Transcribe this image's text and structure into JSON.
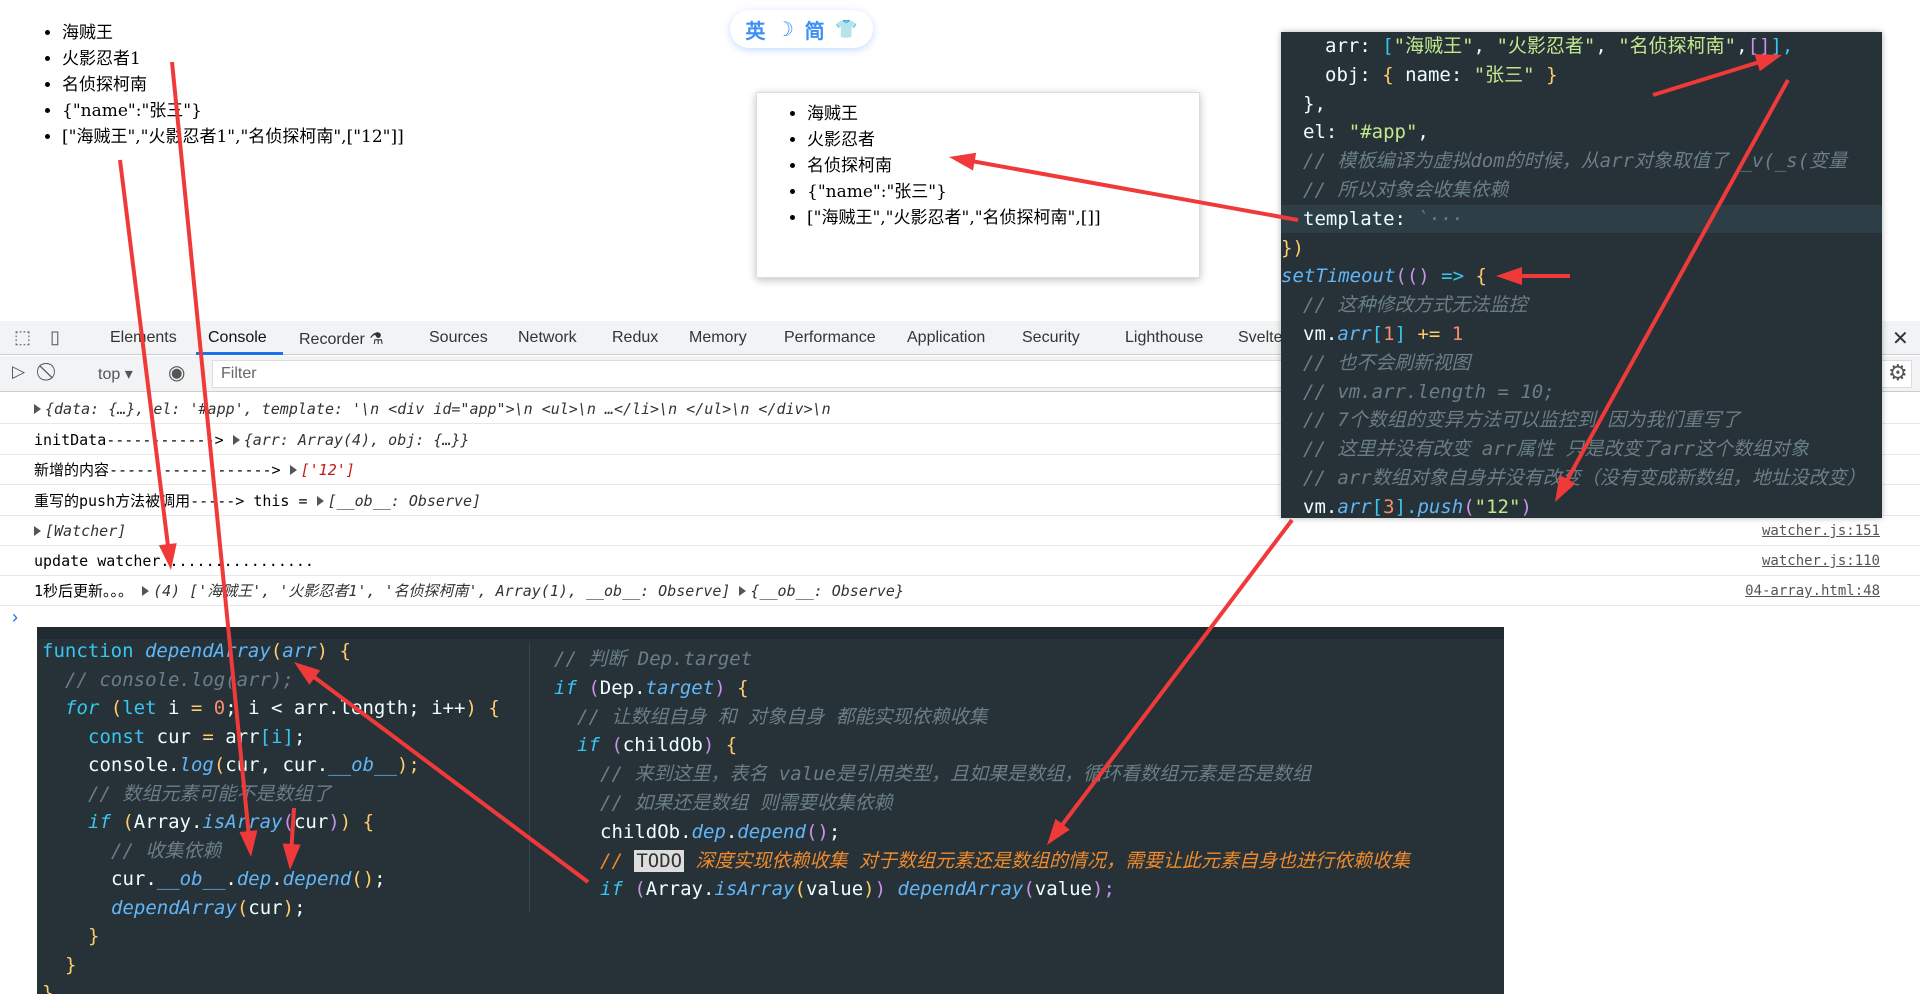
{
  "page": {
    "list": [
      "海贼王",
      "火影忍者1",
      "名侦探柯南",
      "{\"name\":\"张三\"}",
      "[\"海贼王\",\"火影忍者1\",\"名侦探柯南\",[\"12\"]]"
    ]
  },
  "toggle": {
    "lang": "英",
    "moon": "☽",
    "simp": "简",
    "shirt": "👕"
  },
  "preview": {
    "list": [
      "海贼王",
      "火影忍者",
      "名侦探柯南",
      "{\"name\":\"张三\"}",
      "[\"海贼王\",\"火影忍者\",\"名侦探柯南\",[]]"
    ]
  },
  "devtools": {
    "tabs": [
      "Elements",
      "Console",
      "Recorder ⚗",
      "Sources",
      "Network",
      "Redux",
      "Memory",
      "Performance",
      "Application",
      "Security",
      "Lighthouse",
      "Svelte"
    ],
    "active_tab": "Console",
    "context": "top ▾",
    "filter_placeholder": "Filter",
    "close": "✕",
    "settings": "⚙",
    "prompt": "›",
    "rows": [
      {
        "text": "{data: {…}, el: '#app', template: '\\n        <div id=\"app\">\\n          <ul>\\n          …</li>\\n          </ul>\\n        </div>\\n",
        "src": ""
      },
      {
        "text": "initData------------>",
        "obj": "{arr: Array(4), obj: {…}}",
        "src": ""
      },
      {
        "text": "新增的内容------------------>",
        "obj": "['12']",
        "src": ""
      },
      {
        "text": "重写的push方法被调用----->  this = ",
        "obj": "[__ob__: Observe]",
        "src": ""
      },
      {
        "text": "",
        "obj": "[Watcher]",
        "src": "watcher.js:151"
      },
      {
        "text": "update watcher.................",
        "obj": "",
        "src": "watcher.js:110"
      },
      {
        "text": "1秒后更新。。。",
        "obj": "(4) ['海贼王', '火影忍者1', '名侦探柯南', Array(1), __ob__: Observe]",
        "obj2": "{__ob__: Observe}",
        "src": "04-array.html:48"
      }
    ]
  },
  "code_right": [
    [
      2,
      [
        [
          "arr: ",
          "pl"
        ],
        [
          "[",
          "kw"
        ],
        [
          "\"海贼王\"",
          "str"
        ],
        [
          ", ",
          "pl"
        ],
        [
          "\"火影忍者\"",
          "str"
        ],
        [
          ", ",
          "pl"
        ],
        [
          "\"名侦探柯南\"",
          "str"
        ],
        [
          ",",
          "pl"
        ],
        [
          "[]",
          "pk"
        ],
        [
          "],",
          "kw"
        ]
      ]
    ],
    [
      2,
      [
        [
          "obj: ",
          "pl"
        ],
        [
          "{ ",
          "yl"
        ],
        [
          "name: ",
          "pl"
        ],
        [
          "\"张三\"",
          "str"
        ],
        [
          " }",
          "yl"
        ]
      ]
    ],
    [
      1,
      [
        [
          "},",
          "pl"
        ]
      ]
    ],
    [
      1,
      [
        [
          "el: ",
          "pl"
        ],
        [
          "\"#app\"",
          "str"
        ],
        [
          ",",
          "pl"
        ]
      ]
    ],
    [
      1,
      [
        [
          "// 模板编译为虚拟dom的时候，从arr对象取值了 _v(_s(变量",
          "cm"
        ]
      ]
    ],
    [
      1,
      [
        [
          "// 所以对象会收集依赖",
          "cm"
        ]
      ]
    ],
    [
      1,
      [
        [
          "template: ",
          "pl"
        ],
        [
          "`···",
          "cm"
        ]
      ]
    ],
    [
      0,
      [
        [
          "})",
          "yl"
        ]
      ]
    ],
    [
      0,
      [
        [
          "setTimeout",
          "fn"
        ],
        [
          "(() ",
          "pk"
        ],
        [
          "=> ",
          "kw"
        ],
        [
          "{",
          "yl"
        ]
      ]
    ],
    [
      1,
      [
        [
          "// 这种修改方式无法监控",
          "cm"
        ]
      ]
    ],
    [
      1,
      [
        [
          "vm.",
          "pl"
        ],
        [
          "arr",
          "fn"
        ],
        [
          "[",
          "kw"
        ],
        [
          "1",
          "or"
        ],
        [
          "] ",
          "kw"
        ],
        [
          "+= ",
          "yl"
        ],
        [
          "1",
          "or"
        ]
      ]
    ],
    [
      1,
      [
        [
          "// 也不会刷新视图",
          "cm"
        ]
      ]
    ],
    [
      1,
      [
        [
          "// vm.arr.length = 10;",
          "cm"
        ]
      ]
    ],
    [
      1,
      [
        [
          "// 7个数组的变异方法可以监控到 因为我们重写了",
          "cm"
        ]
      ]
    ],
    [
      1,
      [
        [
          "// 这里并没有改变 arr属性 只是改变了arr这个数组对象",
          "cm"
        ]
      ]
    ],
    [
      1,
      [
        [
          "// arr数组对象自身并没有改变（没有变成新数组，地址没改变）",
          "cm"
        ]
      ]
    ],
    [
      1,
      [
        [
          "vm.",
          "pl"
        ],
        [
          "arr",
          "fn"
        ],
        [
          "[",
          "kw"
        ],
        [
          "3",
          "or"
        ],
        [
          "].",
          "kw"
        ],
        [
          "push",
          "fn"
        ],
        [
          "(",
          "pk"
        ],
        [
          "\"12\"",
          "str"
        ],
        [
          ")",
          "pk"
        ]
      ]
    ]
  ],
  "code_bottom": [
    [
      0,
      [
        [
          "function ",
          "kw"
        ],
        [
          "dependArray",
          "fn"
        ],
        [
          "(",
          "yl"
        ],
        [
          "arr",
          "fn"
        ],
        [
          ") ",
          "yl"
        ],
        [
          "{",
          "yl"
        ]
      ]
    ],
    [
      1,
      [
        [
          "// console.log(arr);",
          "cm"
        ]
      ]
    ],
    [
      1,
      [
        [
          "for ",
          "ik"
        ],
        [
          "(",
          "yl"
        ],
        [
          "let ",
          "kw"
        ],
        [
          "i ",
          "pl"
        ],
        [
          "= ",
          "yl"
        ],
        [
          "0",
          "or"
        ],
        [
          "; i < arr.length; i++",
          "pl"
        ],
        [
          ") {",
          "yl"
        ]
      ]
    ],
    [
      2,
      [
        [
          "const ",
          "kw"
        ],
        [
          "cur ",
          "pl"
        ],
        [
          "= ",
          "yl"
        ],
        [
          "arr",
          "pl"
        ],
        [
          "[i]",
          "kw"
        ],
        [
          ";",
          "pl"
        ]
      ]
    ],
    [
      2,
      [
        [
          "console.",
          "pl"
        ],
        [
          "log",
          "fn"
        ],
        [
          "(",
          "yl"
        ],
        [
          "cur, cur.",
          "pl"
        ],
        [
          "__ob__",
          "fn"
        ],
        [
          ");",
          "yl"
        ]
      ]
    ],
    [
      2,
      [
        [
          "// 数组元素可能不是数组了",
          "cm"
        ]
      ]
    ],
    [
      2,
      [
        [
          "if ",
          "ik"
        ],
        [
          "(",
          "yl"
        ],
        [
          "Array.",
          "pl"
        ],
        [
          "isArray",
          "fn"
        ],
        [
          "(",
          "pk"
        ],
        [
          "cur",
          "pl"
        ],
        [
          ")",
          "pk"
        ],
        [
          ") {",
          "yl"
        ]
      ]
    ],
    [
      3,
      [
        [
          "// 收集依赖",
          "cm"
        ]
      ]
    ],
    [
      3,
      [
        [
          "cur.",
          "pl"
        ],
        [
          "__ob__",
          "fn"
        ],
        [
          ".",
          "pl"
        ],
        [
          "dep",
          "fn"
        ],
        [
          ".",
          "pl"
        ],
        [
          "depend",
          "fn"
        ],
        [
          "()",
          "yl"
        ],
        [
          ";",
          "pl"
        ]
      ]
    ],
    [
      3,
      [
        [
          "dependArray",
          "fn"
        ],
        [
          "(",
          "yl"
        ],
        [
          "cur",
          "pl"
        ],
        [
          ")",
          "yl"
        ],
        [
          ";",
          "pl"
        ]
      ]
    ],
    [
      2,
      [
        [
          "}",
          "yl"
        ]
      ]
    ],
    [
      1,
      [
        [
          "}",
          "yl"
        ]
      ]
    ],
    [
      0,
      [
        [
          "}",
          "yl"
        ]
      ]
    ]
  ],
  "code_inner": [
    [
      0,
      [
        [
          "// 判断 Dep.target",
          "cm"
        ]
      ]
    ],
    [
      0,
      [
        [
          "if ",
          "ik"
        ],
        [
          "(",
          "pk"
        ],
        [
          "Dep.",
          "pl"
        ],
        [
          "target",
          "fn"
        ],
        [
          ") ",
          "pk"
        ],
        [
          "{",
          "yl"
        ]
      ]
    ],
    [
      1,
      [
        [
          "// 让数组自身 和 对象自身 都能实现依赖收集",
          "cm"
        ]
      ]
    ],
    [
      1,
      [
        [
          "if ",
          "ik"
        ],
        [
          "(",
          "pk"
        ],
        [
          "childOb",
          "pl"
        ],
        [
          ") ",
          "pk"
        ],
        [
          "{",
          "yl"
        ]
      ]
    ],
    [
      2,
      [
        [
          "// 来到这里，表名 value是引用类型，且如果是数组，循环看数组元素是否是数组",
          "cm"
        ]
      ]
    ],
    [
      2,
      [
        [
          "// 如果还是数组 则需要收集依赖",
          "cm"
        ]
      ]
    ],
    [
      2,
      [
        [
          "childOb.",
          "pl"
        ],
        [
          "dep",
          "fn"
        ],
        [
          ".",
          "pl"
        ],
        [
          "depend",
          "fn"
        ],
        [
          "()",
          "pk"
        ],
        [
          ";",
          "pl"
        ]
      ]
    ],
    [
      2,
      [
        [
          "// ",
          "todo"
        ],
        [
          "TODO",
          "todobox"
        ],
        [
          " 深度实现依赖收集 对于数组元素还是数组的情况，需要让此元素自身也进行依赖收集",
          "todo"
        ]
      ]
    ],
    [
      2,
      [
        [
          "if ",
          "ik"
        ],
        [
          "(",
          "pk"
        ],
        [
          "Array.",
          "pl"
        ],
        [
          "isArray",
          "fn"
        ],
        [
          "(",
          "yl"
        ],
        [
          "value",
          "pl"
        ],
        [
          ")",
          "yl"
        ],
        [
          ") ",
          "pk"
        ],
        [
          "dependArray",
          "fn"
        ],
        [
          "(",
          "pk"
        ],
        [
          "value",
          "pl"
        ],
        [
          ");",
          "pk"
        ]
      ]
    ]
  ],
  "colors": {
    "annotation_arrow": "#f03a3a",
    "accent": "#1a73e8",
    "code_bg": "#263238"
  }
}
